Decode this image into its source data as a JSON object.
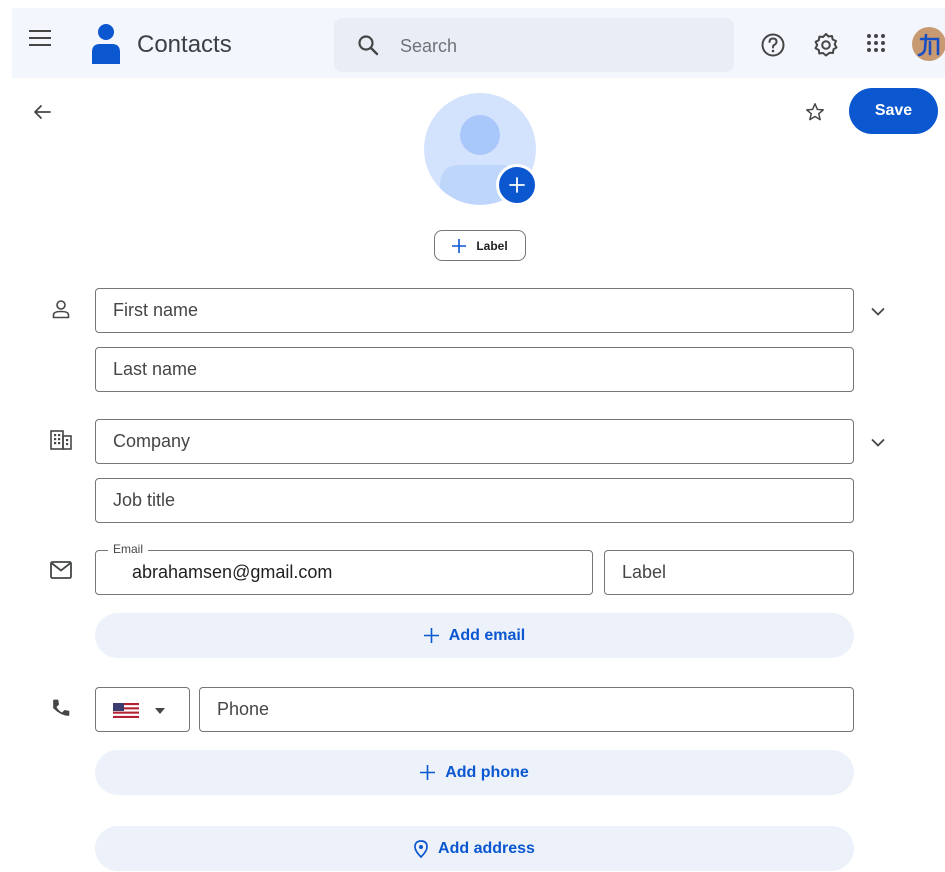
{
  "header": {
    "app_title": "Contacts",
    "search_placeholder": "Search"
  },
  "actions": {
    "save_label": "Save"
  },
  "photo": {
    "label_chip": "Label"
  },
  "form": {
    "first_name_placeholder": "First name",
    "last_name_placeholder": "Last name",
    "company_placeholder": "Company",
    "job_title_placeholder": "Job title",
    "email_label": "Email",
    "email_value": "abrahamsen@gmail.com",
    "email_type_placeholder": "Label",
    "add_email": "Add email",
    "phone_placeholder": "Phone",
    "add_phone": "Add phone",
    "add_address": "Add address"
  },
  "colors": {
    "accent": "#0b57d0",
    "header_bg": "#f3f6fc",
    "pill_bg": "#edf2fa"
  },
  "icons": {
    "menu": "menu-icon",
    "search": "search-icon",
    "help": "help-icon",
    "settings": "settings-icon",
    "apps": "apps-grid-icon",
    "back": "arrow-back-icon",
    "star": "star-outline-icon",
    "person": "person-icon",
    "building": "building-icon",
    "mail": "mail-icon",
    "phone": "phone-icon",
    "location": "location-pin-icon",
    "flag": "us-flag-icon"
  }
}
